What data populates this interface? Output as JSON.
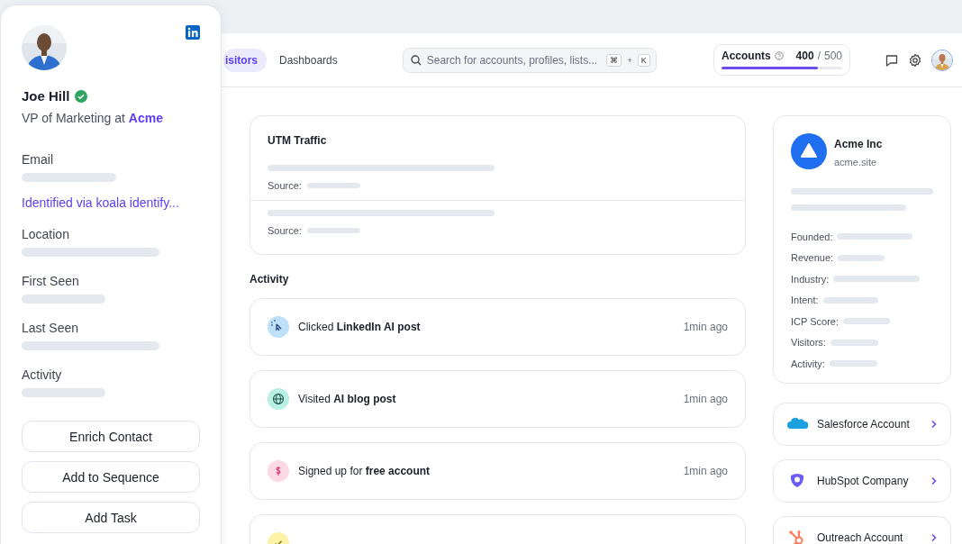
{
  "contact": {
    "name": "Joe Hill",
    "verified": true,
    "title": "VP of Marketing at **Acme**",
    "fields": [
      {
        "label": "Email",
        "note": "Identified via koala identify..."
      },
      {
        "label": "Location"
      },
      {
        "label": "First Seen"
      },
      {
        "label": "Last Seen"
      },
      {
        "label": "Activity"
      }
    ],
    "buttons": [
      "Enrich Contact",
      "Add to Sequence",
      "Add Task"
    ]
  },
  "nav": {
    "tabs": [
      {
        "label": "isitors",
        "selected": true
      },
      {
        "label": "Dashboards",
        "selected": false
      }
    ]
  },
  "search": {
    "placeholder": "Search for accounts, profiles, lists...",
    "shortcut": [
      "⌘",
      "+",
      "K"
    ]
  },
  "accounts": {
    "label": "Accounts",
    "used": "400",
    "separator": "/",
    "total": "500",
    "level": 0.8
  },
  "utm": {
    "title": "UTM Traffic",
    "rows": [
      {
        "label": "Source:"
      },
      {
        "label": "Source:"
      }
    ]
  },
  "activity": {
    "title": "Activity",
    "items": [
      {
        "kind": "cursor",
        "color": "#bfe0fa",
        "text": "Clicked **LinkedIn AI post**",
        "time": "1min ago"
      },
      {
        "kind": "globe",
        "color": "#b9f0e4",
        "text": "Visited **AI blog post**",
        "time": "1min ago"
      },
      {
        "kind": "dollar",
        "color": "#fcd9e4",
        "text": "Signed up for **free account**",
        "time": "1min ago"
      },
      {
        "kind": "check",
        "color": "#fcf3a8"
      }
    ]
  },
  "company": {
    "name": "Acme Inc",
    "domain": "acme.site",
    "fields": [
      "Founded:",
      "Revenue:",
      "Industry:",
      "Intent:",
      "ICP Score:",
      "Visitors:",
      "Activity:"
    ]
  },
  "integrations": [
    {
      "kind": "salesforce",
      "label": "Salesforce Account"
    },
    {
      "kind": "hubspot",
      "label": "HubSpot Company"
    },
    {
      "kind": "outreach",
      "label": "Outreach Account"
    }
  ]
}
